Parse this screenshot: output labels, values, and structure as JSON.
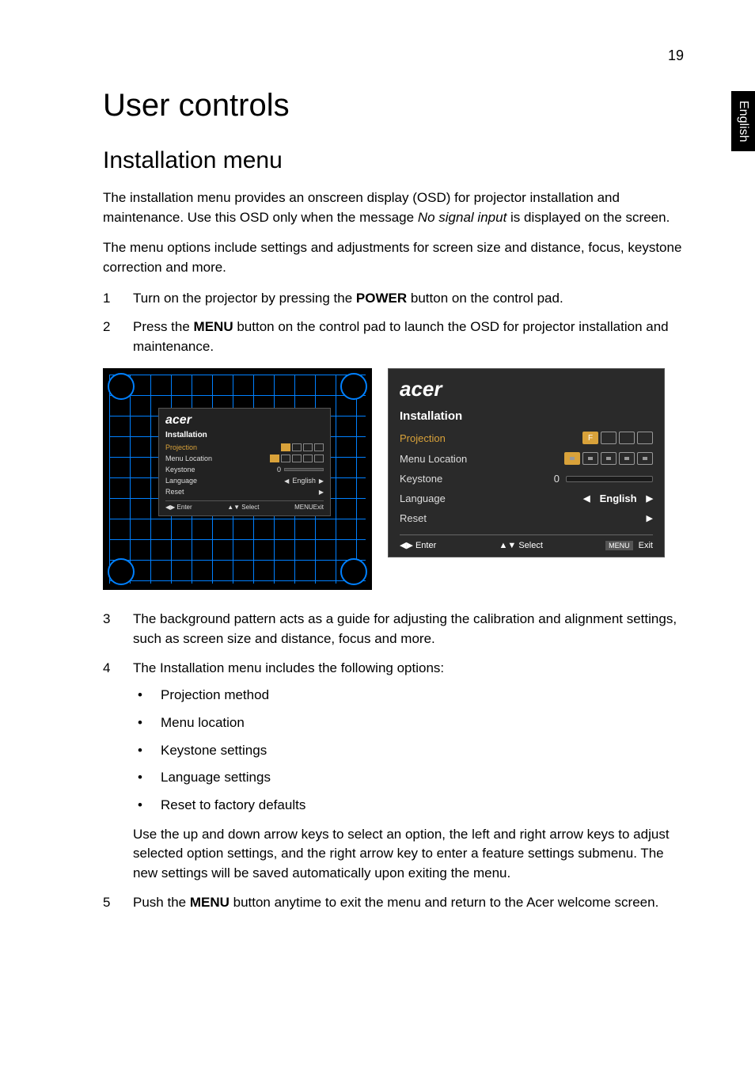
{
  "page_number": "19",
  "side_tab": "English",
  "heading1": "User controls",
  "heading2": "Installation menu",
  "intro_p1_a": "The installation menu provides an onscreen display (OSD) for projector installation and maintenance. Use this OSD only when the message ",
  "intro_p1_italic": "No signal input",
  "intro_p1_b": " is displayed on the screen.",
  "intro_p2": "The menu options include settings and adjustments for screen size and distance, focus, keystone correction and more.",
  "step1_a": "Turn on the projector by pressing the ",
  "step1_bold": "POWER",
  "step1_b": " button on the control pad.",
  "step2_a": "Press the ",
  "step2_bold": "MENU",
  "step2_b": " button on the control pad to launch the OSD for projector installation and maintenance.",
  "osd": {
    "brand": "acer",
    "title": "Installation",
    "rows": {
      "projection": "Projection",
      "menu_location": "Menu Location",
      "keystone": "Keystone",
      "keystone_val": "0",
      "language": "Language",
      "language_val": "English",
      "reset": "Reset"
    },
    "projection_icons": [
      "F",
      "⇵",
      "⇄",
      "⇆"
    ],
    "bottom": {
      "enter": "◀▶ Enter",
      "select": "▲▼ Select",
      "menu": "MENU",
      "exit": "Exit"
    }
  },
  "step3": "The background pattern acts as a guide for adjusting the calibration and alignment settings, such as screen size and distance, focus and more.",
  "step4": "The Installation menu includes the following options:",
  "bullets": [
    "Projection method",
    "Menu location",
    "Keystone settings",
    "Language settings",
    "Reset to factory defaults"
  ],
  "step4_after": "Use the up and down arrow keys to select an option, the left and right arrow keys to adjust selected option settings, and the right arrow key to enter a feature settings submenu. The new settings will be saved automatically upon exiting the menu.",
  "step5_a": "Push the ",
  "step5_bold": "MENU",
  "step5_b": " button anytime to exit the menu and return to the Acer welcome screen."
}
